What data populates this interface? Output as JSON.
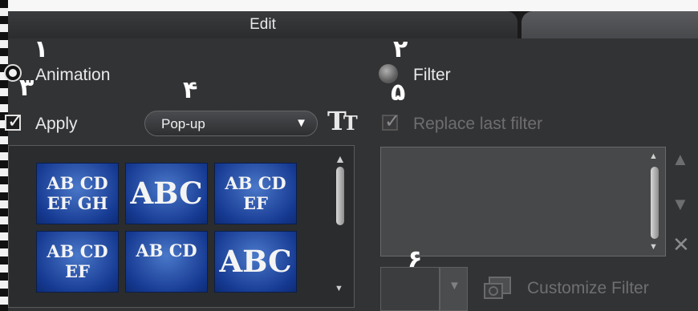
{
  "header": {
    "tab_edit": "Edit"
  },
  "left": {
    "animation_label": "Animation",
    "apply_label": "Apply",
    "dropdown_value": "Pop-up",
    "thumbnails": [
      "AB CD EF GH",
      "ABC",
      "AB CD EF",
      "AB CD EF",
      "AB CD",
      "ABC"
    ]
  },
  "right": {
    "filter_label": "Filter",
    "replace_label": "Replace last filter",
    "customize_label": "Customize Filter"
  },
  "markers": {
    "m1": "١",
    "m2": "٢",
    "m3": "٣",
    "m4": "۴",
    "m5": "۵",
    "m6": "۶"
  },
  "colors": {
    "panel": "#323335",
    "thumb_blue": "#1a3e96",
    "accent_text": "#e9e9e9"
  },
  "icons": {
    "text_style": "TT",
    "scroll_up": "▲",
    "scroll_down": "▼",
    "remove": "✕"
  }
}
